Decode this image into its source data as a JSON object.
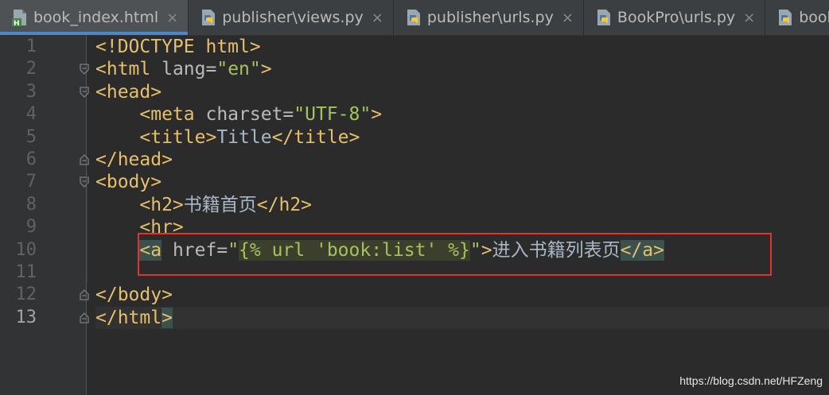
{
  "tabs": [
    {
      "label": "book_index.html",
      "icon": "html-file-icon",
      "active": true
    },
    {
      "label": "publisher\\views.py",
      "icon": "python-file-icon",
      "active": false
    },
    {
      "label": "publisher\\urls.py",
      "icon": "python-file-icon",
      "active": false
    },
    {
      "label": "BookPro\\urls.py",
      "icon": "python-file-icon",
      "active": false
    },
    {
      "label": "book\\urls.py",
      "icon": "python-file-icon",
      "active": false
    }
  ],
  "close_glyph": "×",
  "line_numbers": [
    "1",
    "2",
    "3",
    "4",
    "5",
    "6",
    "7",
    "8",
    "9",
    "10",
    "11",
    "12",
    "13"
  ],
  "code": {
    "l1": {
      "doctype": "<!DOCTYPE html>"
    },
    "l2": {
      "open": "<html",
      "attr": " lang=",
      "val": "\"en\"",
      "close": ">"
    },
    "l3": {
      "tag": "<head>"
    },
    "l4": {
      "indent": "    ",
      "open": "<meta",
      "attr": " charset=",
      "val": "\"UTF-8\"",
      "close": ">"
    },
    "l5": {
      "indent": "    ",
      "open": "<title>",
      "text": "Title",
      "close": "</title>"
    },
    "l6": {
      "tag": "</head>"
    },
    "l7": {
      "tag": "<body>"
    },
    "l8": {
      "indent": "    ",
      "open": "<h2>",
      "text": "书籍首页",
      "close": "</h2>"
    },
    "l9": {
      "indent": "    ",
      "tag": "<hr>"
    },
    "l10": {
      "indent": "    ",
      "open": "<a",
      "attr": " href=",
      "q1": "\"",
      "template": "{% url 'book:list' %}",
      "q2": "\"",
      "gt": ">",
      "text": "进入书籍列表页",
      "close": "</a>"
    },
    "l11": {
      "text": ""
    },
    "l12": {
      "tag": "</body>"
    },
    "l13": {
      "open": "</html",
      "close": ">"
    }
  },
  "watermark": "https://blog.csdn.net/HFZeng",
  "colors": {
    "background": "#2b2b2b",
    "tag": "#e8bf6a",
    "string": "#a5c25c",
    "annotation_box": "#e5332a",
    "tab_underline": "#4a88c7"
  }
}
